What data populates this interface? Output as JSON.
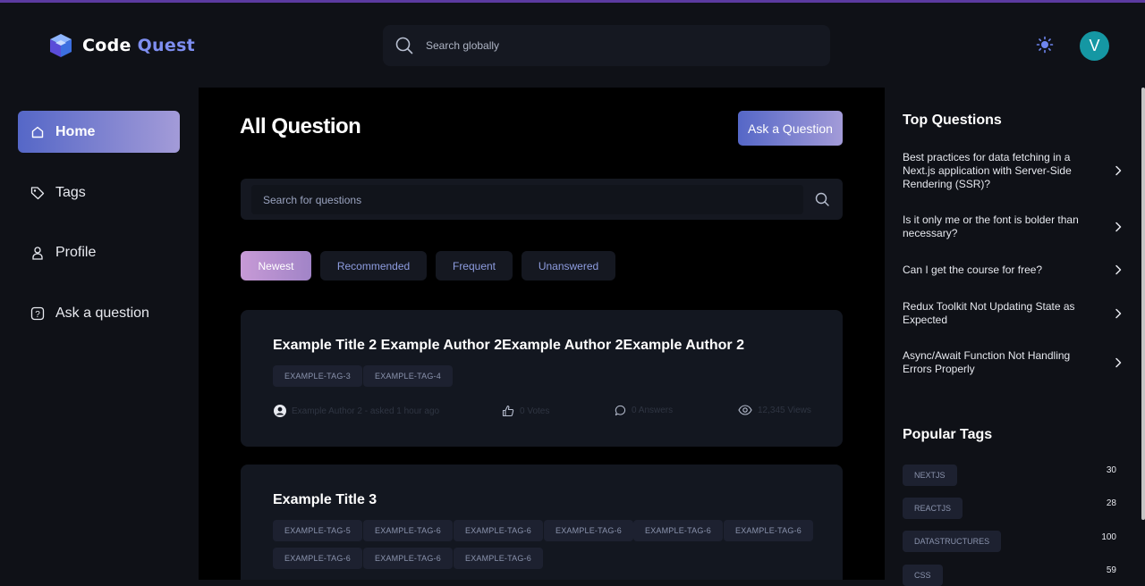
{
  "app": {
    "name_part1": "Code",
    "name_part2": "Quest",
    "accent": "#7e8ef0"
  },
  "header": {
    "search_placeholder": "Search globally",
    "avatar_initial": "V",
    "theme_icon": "sun-icon",
    "search_icon": "search-icon"
  },
  "sidebar": {
    "items": [
      {
        "label": "Home",
        "icon": "home-icon",
        "active": true
      },
      {
        "label": "Tags",
        "icon": "tag-icon",
        "active": false
      },
      {
        "label": "Profile",
        "icon": "user-icon",
        "active": false
      },
      {
        "label": "Ask a question",
        "icon": "question-icon",
        "active": false
      }
    ]
  },
  "main": {
    "title": "All Question",
    "ask_button": "Ask a Question",
    "search_placeholder": "Search for questions",
    "filters": [
      "Newest",
      "Recommended",
      "Frequent",
      "Unanswered"
    ],
    "questions": [
      {
        "title": "Example Title 2 Example Author 2Example Author 2Example Author 2",
        "tags": [
          "EXAMPLE-TAG-3",
          "EXAMPLE-TAG-4"
        ],
        "author_line": "Example Author 2 - asked 1 hour ago",
        "votes": "0 Votes",
        "answers": "0 Answers",
        "views": "12,345 Views"
      },
      {
        "title": "Example Title 3",
        "tags": [
          "EXAMPLE-TAG-5",
          "EXAMPLE-TAG-6",
          "EXAMPLE-TAG-6",
          "EXAMPLE-TAG-6",
          "EXAMPLE-TAG-6",
          "EXAMPLE-TAG-6",
          "EXAMPLE-TAG-6",
          "EXAMPLE-TAG-6",
          "EXAMPLE-TAG-6"
        ]
      }
    ]
  },
  "right": {
    "top_title": "Top Questions",
    "top_questions": [
      "Best practices for data fetching in a Next.js application with Server-Side Rendering (SSR)?",
      "Is it only me or the font is bolder than necessary?",
      "Can I get the course for free?",
      "Redux Toolkit Not Updating State as Expected",
      "Async/Await Function Not Handling Errors Properly"
    ],
    "tags_title": "Popular Tags",
    "popular_tags": [
      {
        "name": "NEXTJS",
        "count": "30"
      },
      {
        "name": "REACTJS",
        "count": "28"
      },
      {
        "name": "DATASTRUCTURES",
        "count": "100"
      },
      {
        "name": "CSS",
        "count": "59"
      }
    ]
  }
}
